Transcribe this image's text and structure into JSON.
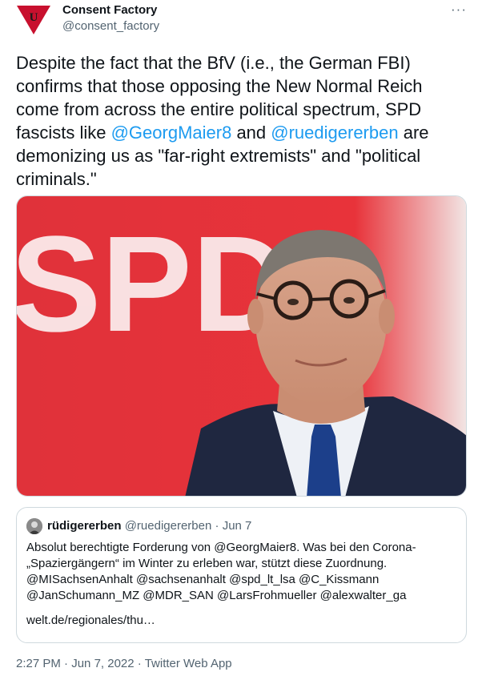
{
  "author": {
    "name": "Consent Factory",
    "handle": "@consent_factory",
    "avatar_icon": "red-triangle-u-logo-icon",
    "avatar_letter": "U",
    "avatar_color": "#c8102e"
  },
  "more_icon": "more-options-icon",
  "more_label": "···",
  "tweet": {
    "text_1": "Despite the fact that the BfV (i.e., the German FBI) confirms that those opposing the New Normal Reich come from across the entire political spectrum, SPD fascists like ",
    "mention_1": "@GeorgMaier8",
    "text_2": " and ",
    "mention_2": "@ruedigererben",
    "text_3": " are demonizing us as \"far-right extremists\" and \"political criminals.\""
  },
  "media": {
    "alt_letters": "SPD",
    "background_color": "#e3000f"
  },
  "quote": {
    "name": "rüdigererben",
    "handle": "@ruedigererben",
    "dot": " · ",
    "date": "Jun 7",
    "body_lines": [
      "Absolut berechtigte Forderung von @GeorgMaier8. Was  bei den Corona-",
      "„Spaziergängern“ im Winter zu erleben war, stützt diese Zuordnung.",
      "@MISachsenAnhalt @sachsenanhalt @spd_lt_lsa @C_Kissmann",
      "@JanSchumann_MZ @MDR_SAN @LarsFrohmueller @alexwalter_ga"
    ],
    "link": "welt.de/regionales/thu…"
  },
  "footer": {
    "time": "2:27 PM",
    "sep_1": " · ",
    "date": "Jun 7, 2022",
    "sep_2": " · ",
    "source": "Twitter Web App"
  },
  "colors": {
    "link": "#1d9bf0",
    "secondary_text": "#536471",
    "border": "#cfd9de"
  }
}
